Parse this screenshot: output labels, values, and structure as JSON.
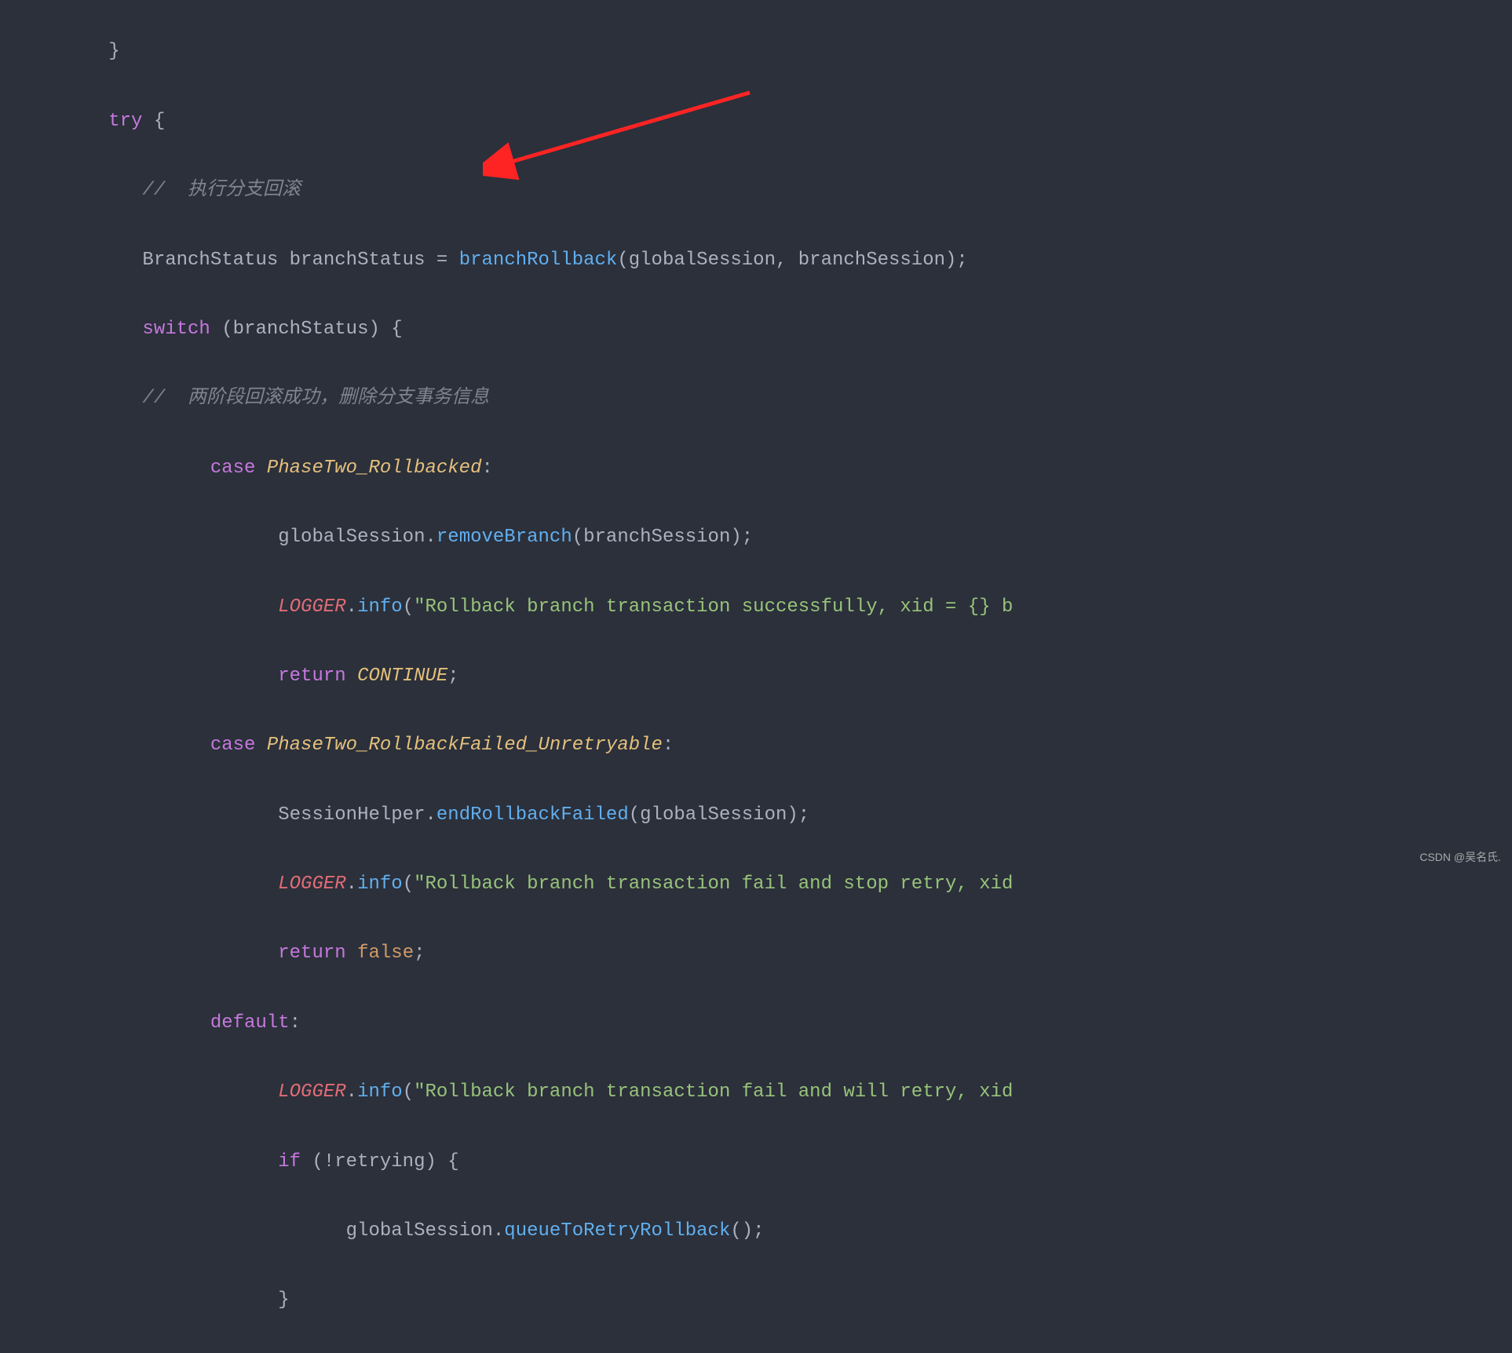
{
  "code": {
    "l0_brace": "}",
    "l1_try": "try",
    "l1_brace": " {",
    "l2_comment": "//  执行分支回滚",
    "l3_type": "BranchStatus ",
    "l3_var": "branchStatus = ",
    "l3_call": "branchRollback",
    "l3_args": "(globalSession, branchSession);",
    "l4_switch": "switch",
    "l4_cond": " (branchStatus) {",
    "l5_comment": "//  两阶段回滚成功，删除分支事务信息",
    "l6_case": "case",
    "l6_label": " PhaseTwo_Rollbacked",
    "l6_colon": ":",
    "l7_obj": "globalSession.",
    "l7_method": "removeBranch",
    "l7_args": "(branchSession);",
    "l8_logger": "LOGGER",
    "l8_dot": ".",
    "l8_info": "info",
    "l8_paren": "(",
    "l8_str": "\"Rollback branch transaction successfully, xid = {} b",
    "l9_return": "return",
    "l9_val": " CONTINUE",
    "l9_semi": ";",
    "l10_case": "case",
    "l10_label": " PhaseTwo_RollbackFailed_Unretryable",
    "l10_colon": ":",
    "l11_obj": "SessionHelper.",
    "l11_method": "endRollbackFailed",
    "l11_args": "(globalSession);",
    "l12_logger": "LOGGER",
    "l12_dot": ".",
    "l12_info": "info",
    "l12_paren": "(",
    "l12_str": "\"Rollback branch transaction fail and stop retry, xid",
    "l13_return": "return",
    "l13_space": " ",
    "l13_val": "false",
    "l13_semi": ";",
    "l14_default": "default",
    "l14_colon": ":",
    "l15_logger": "LOGGER",
    "l15_dot": ".",
    "l15_info": "info",
    "l15_paren": "(",
    "l15_str": "\"Rollback branch transaction fail and will retry, xid",
    "l16_if": "if",
    "l16_cond": " (!retrying) {",
    "l17_obj": "globalSession.",
    "l17_method": "queueToRetryRollback",
    "l17_args": "();",
    "l18_brace": "}"
  },
  "indent": {
    "i0": "   ",
    "i1": "      ",
    "i2": "            ",
    "i3": "                  ",
    "i4": "                        "
  },
  "watermark": "CSDN @吴名氏."
}
